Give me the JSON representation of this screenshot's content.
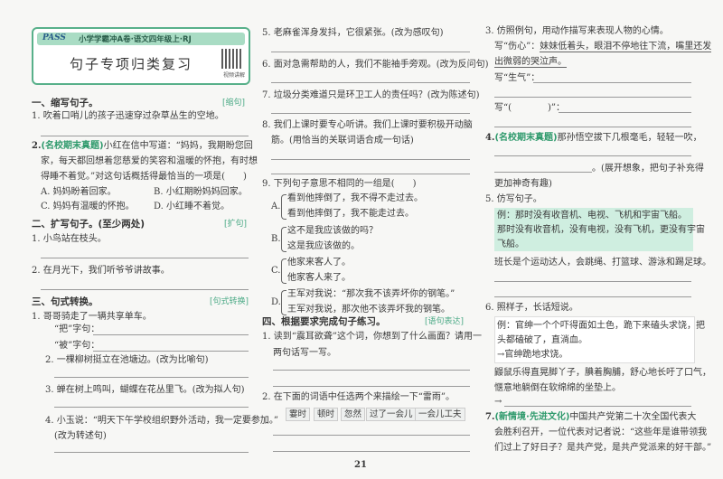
{
  "header": {
    "logo": "PASS",
    "series": "小学学霸冲A卷·语文四年级上·RJ",
    "title": "句子专项归类复习",
    "qr_label": "视频讲解"
  },
  "left": {
    "s1": {
      "heading": "一、缩写句子。",
      "tag": "[缩句]",
      "q1": "1. 吹着口哨儿的孩子迅速穿过杂草丛生的空地。",
      "q2_num": "2.",
      "q2_src": "(名校期末真题)",
      "q2_l1": "小红在信中写道：“妈妈，我期盼您回",
      "q2_l2": "家，每天都回想着您慈爱的笑容和温暖的怀抱，有时想",
      "q2_l3": "得睡不着觉。”对这句话概括得最恰当的一项是(　　)",
      "opts": [
        "A. 妈妈盼着回家。",
        "B. 小红期盼妈妈回家。",
        "C. 妈妈有温暖的怀抱。",
        "D. 小红睡不着觉。"
      ]
    },
    "s2": {
      "heading": "二、扩写句子。(至少两处)",
      "tag": "[扩句]",
      "q1": "1. 小鸟站在枝头。",
      "q2": "2. 在月光下，我们听爷爷讲故事。"
    },
    "s3": {
      "heading": "三、句式转换。",
      "tag": "[句式转换]",
      "q1": "1. 哥哥骑走了一辆共享单车。",
      "ba": "“把”字句：",
      "bei": "“被”字句：",
      "q2": "2. 一棵柳树挺立在池塘边。(改为比喻句)",
      "q3": "3. 蝉在树上鸣叫，蝴蝶在花丛里飞。(改为拟人句)",
      "q4_l1": "4. 小玉说：“明天下午学校组织野外活动，我一定要参加。”",
      "q4_l2": "(改为转述句)"
    }
  },
  "middle": {
    "q5": "5. 老麻雀浑身发抖，它很紧张。(改为感叹句)",
    "q6": "6. 面对急需帮助的人，我们不能袖手旁观。(改为反问句)",
    "q7": "7. 垃圾分类难道只是环卫工人的责任吗？(改为陈述句)",
    "q8_l1": "8. 我们上课时要专心听讲。我们上课时要积极开动脑",
    "q8_l2": "筋。(用恰当的关联词语合成一句话)",
    "q9": "9. 下列句子意思不相同的一组是(　　)",
    "q9_opts": [
      {
        "label": "A.",
        "s1": "看到他摔倒了，我不得不走过去。",
        "s2": "看到他摔倒了，我不能走过去。"
      },
      {
        "label": "B.",
        "s1": "这不是我应该做的吗？",
        "s2": "这是我应该做的。"
      },
      {
        "label": "C.",
        "s1": "他家来客人了。",
        "s2": "他家客人来了。"
      },
      {
        "label": "D.",
        "s1": "王军对我说：“那次我不该弄坏你的钢笔。”",
        "s2": "王军对我说，那次他不该弄坏我的钢笔。"
      }
    ],
    "s4": {
      "heading": "四、根据要求完成句子练习。",
      "tag": "[语句表达]",
      "q1_l1": "1. 读到“震耳欲聋”这个词，你想到了什么画面？请用一",
      "q1_l2": "两句话写一写。",
      "q2": "2. 在下面的词语中任选两个来描绘一下“雷雨”。",
      "words": [
        "霎时",
        "顿时",
        "忽然",
        "过了一会儿",
        "一会儿工夫"
      ]
    },
    "page_number": "21"
  },
  "right": {
    "q3": "3. 仿照例句，用动作描写来表现人物的心情。",
    "q3_ex_label": "写“伤心”：",
    "q3_ex_l1": "妹妹低着头，眼泪不停地往下流，嘴里还发",
    "q3_ex_l2": "出微弱的哭泣声。",
    "q3_angry": "写“生气”：",
    "q3_blank": "写“(　　　　)”：",
    "q4_num": "4.",
    "q4_src": "(名校期末真题)",
    "q4_text": "那孙悟空拔下几根毫毛，轻轻一吹，",
    "q4_l2": "。(展开想象，把句子补充得",
    "q4_l3": "更加神奇有趣)",
    "q5": "5. 仿写句子。",
    "q5_ex": [
      "例：那时没有收音机、电视、飞机和宇宙飞船。",
      "那时没有收音机，没有电视，没有飞机，更没有宇宙",
      "飞船。"
    ],
    "q5_task": "班长是个运动达人，会跳绳、打篮球、游泳和踢足球。",
    "q6": "6. 照样子，长话短说。",
    "q6_ex": [
      "例：官绅一个个吓得面如土色，跪下来磕头求饶，把",
      "头都磕破了，直淌血。",
      "→官绅跪地求饶。"
    ],
    "q6_task": [
      "鼹鼠乐得直晃脚丫子，腆着胸脯，舒心地长吁了口气，",
      "惬意地躺倒在软绵绵的坐垫上。"
    ],
    "q6_arrow": "→",
    "q7_num": "7.",
    "q7_src": "(新情境·先进文化)",
    "q7_l1": "中国共产党第二十次全国代表大",
    "q7_l2": "会胜利召开，一位代表对记者说：“这些年是谁带领我",
    "q7_l3": "们过上了好日子？是共产党，是共产党派来的好干部。”"
  }
}
